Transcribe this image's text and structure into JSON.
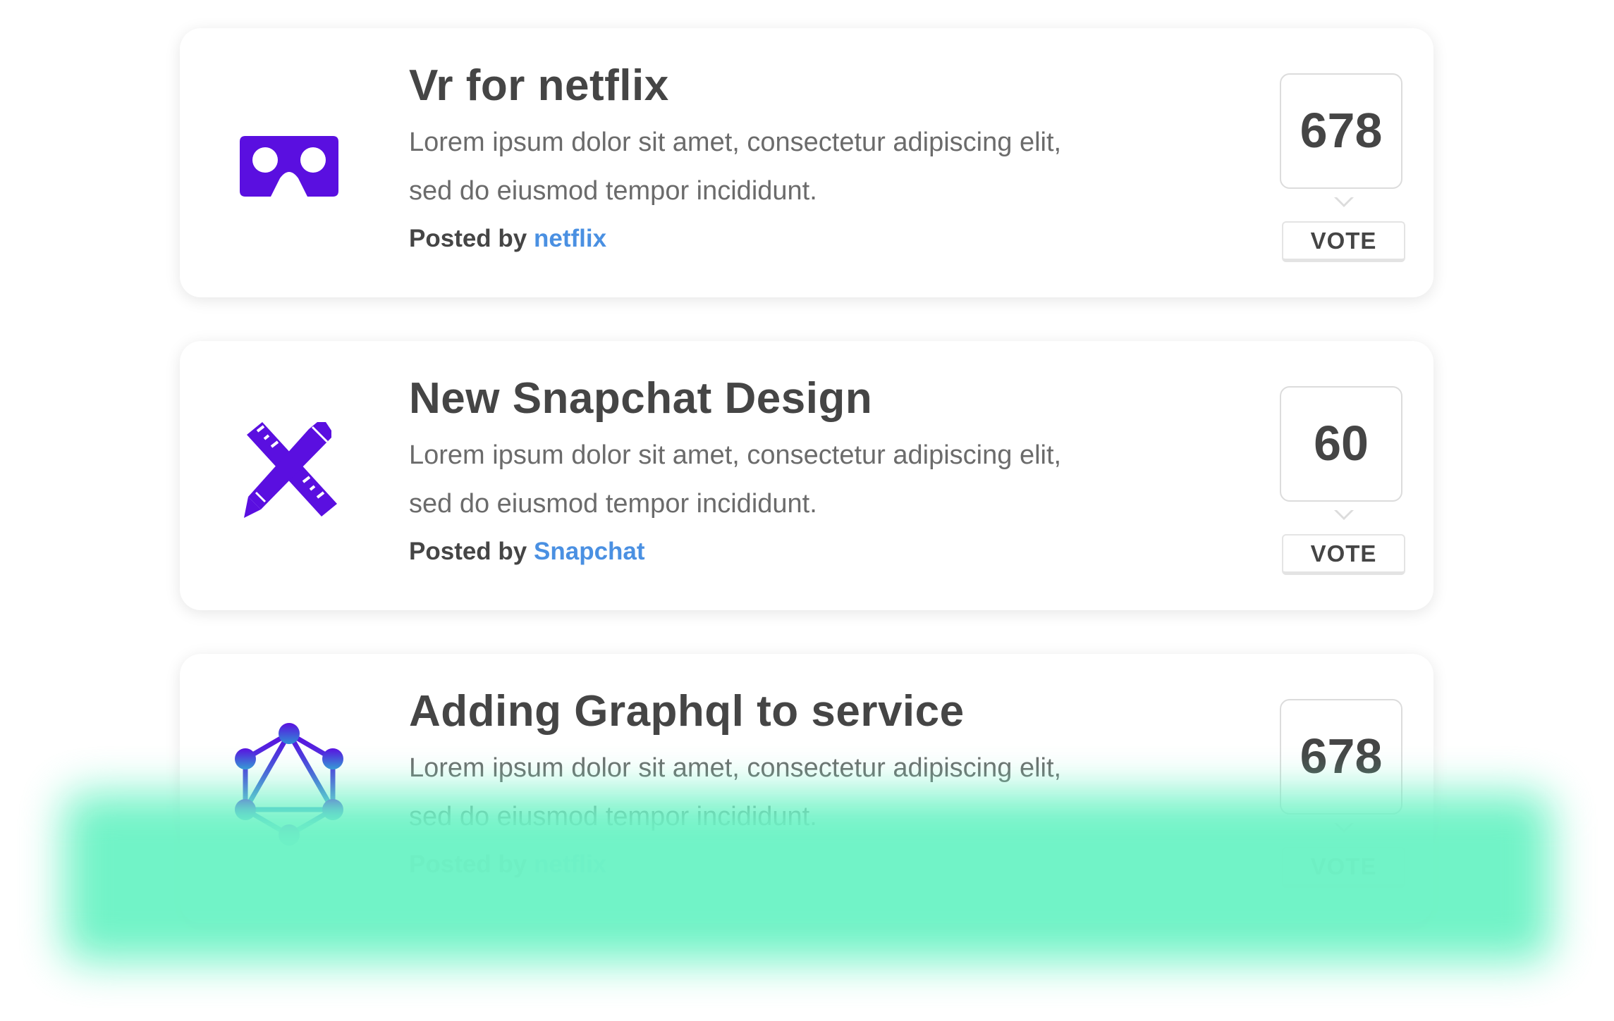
{
  "colors": {
    "icon": "#5a0fe0",
    "author_link": "#4a90e2",
    "highlight": "#6ff3c6",
    "title_text": "#454545",
    "desc_text": "#6b6b6b"
  },
  "posts": [
    {
      "title": "Vr for netflix",
      "description_line1": "Lorem ipsum dolor sit amet, consectetur adipiscing elit,",
      "description_line2": "sed do eiusmod tempor incididunt.",
      "posted_by_label": "Posted by",
      "author": "netflix",
      "votes": "678",
      "vote_label": "VOTE",
      "icon": "vr-headset-icon"
    },
    {
      "title": "New Snapchat Design",
      "description_line1": "Lorem ipsum dolor sit amet, consectetur adipiscing elit,",
      "description_line2": "sed do eiusmod tempor incididunt.",
      "posted_by_label": "Posted by",
      "author": "Snapchat",
      "votes": "60",
      "vote_label": "VOTE",
      "icon": "ruler-pencil-icon"
    },
    {
      "title": "Adding Graphql to service",
      "description_line1": "Lorem ipsum dolor sit amet, consectetur adipiscing elit,",
      "description_line2": "sed do eiusmod tempor incididunt.",
      "posted_by_label": "Posted by",
      "author": "netflix",
      "votes": "678",
      "vote_label": "VOTE",
      "icon": "graphql-icon"
    }
  ]
}
